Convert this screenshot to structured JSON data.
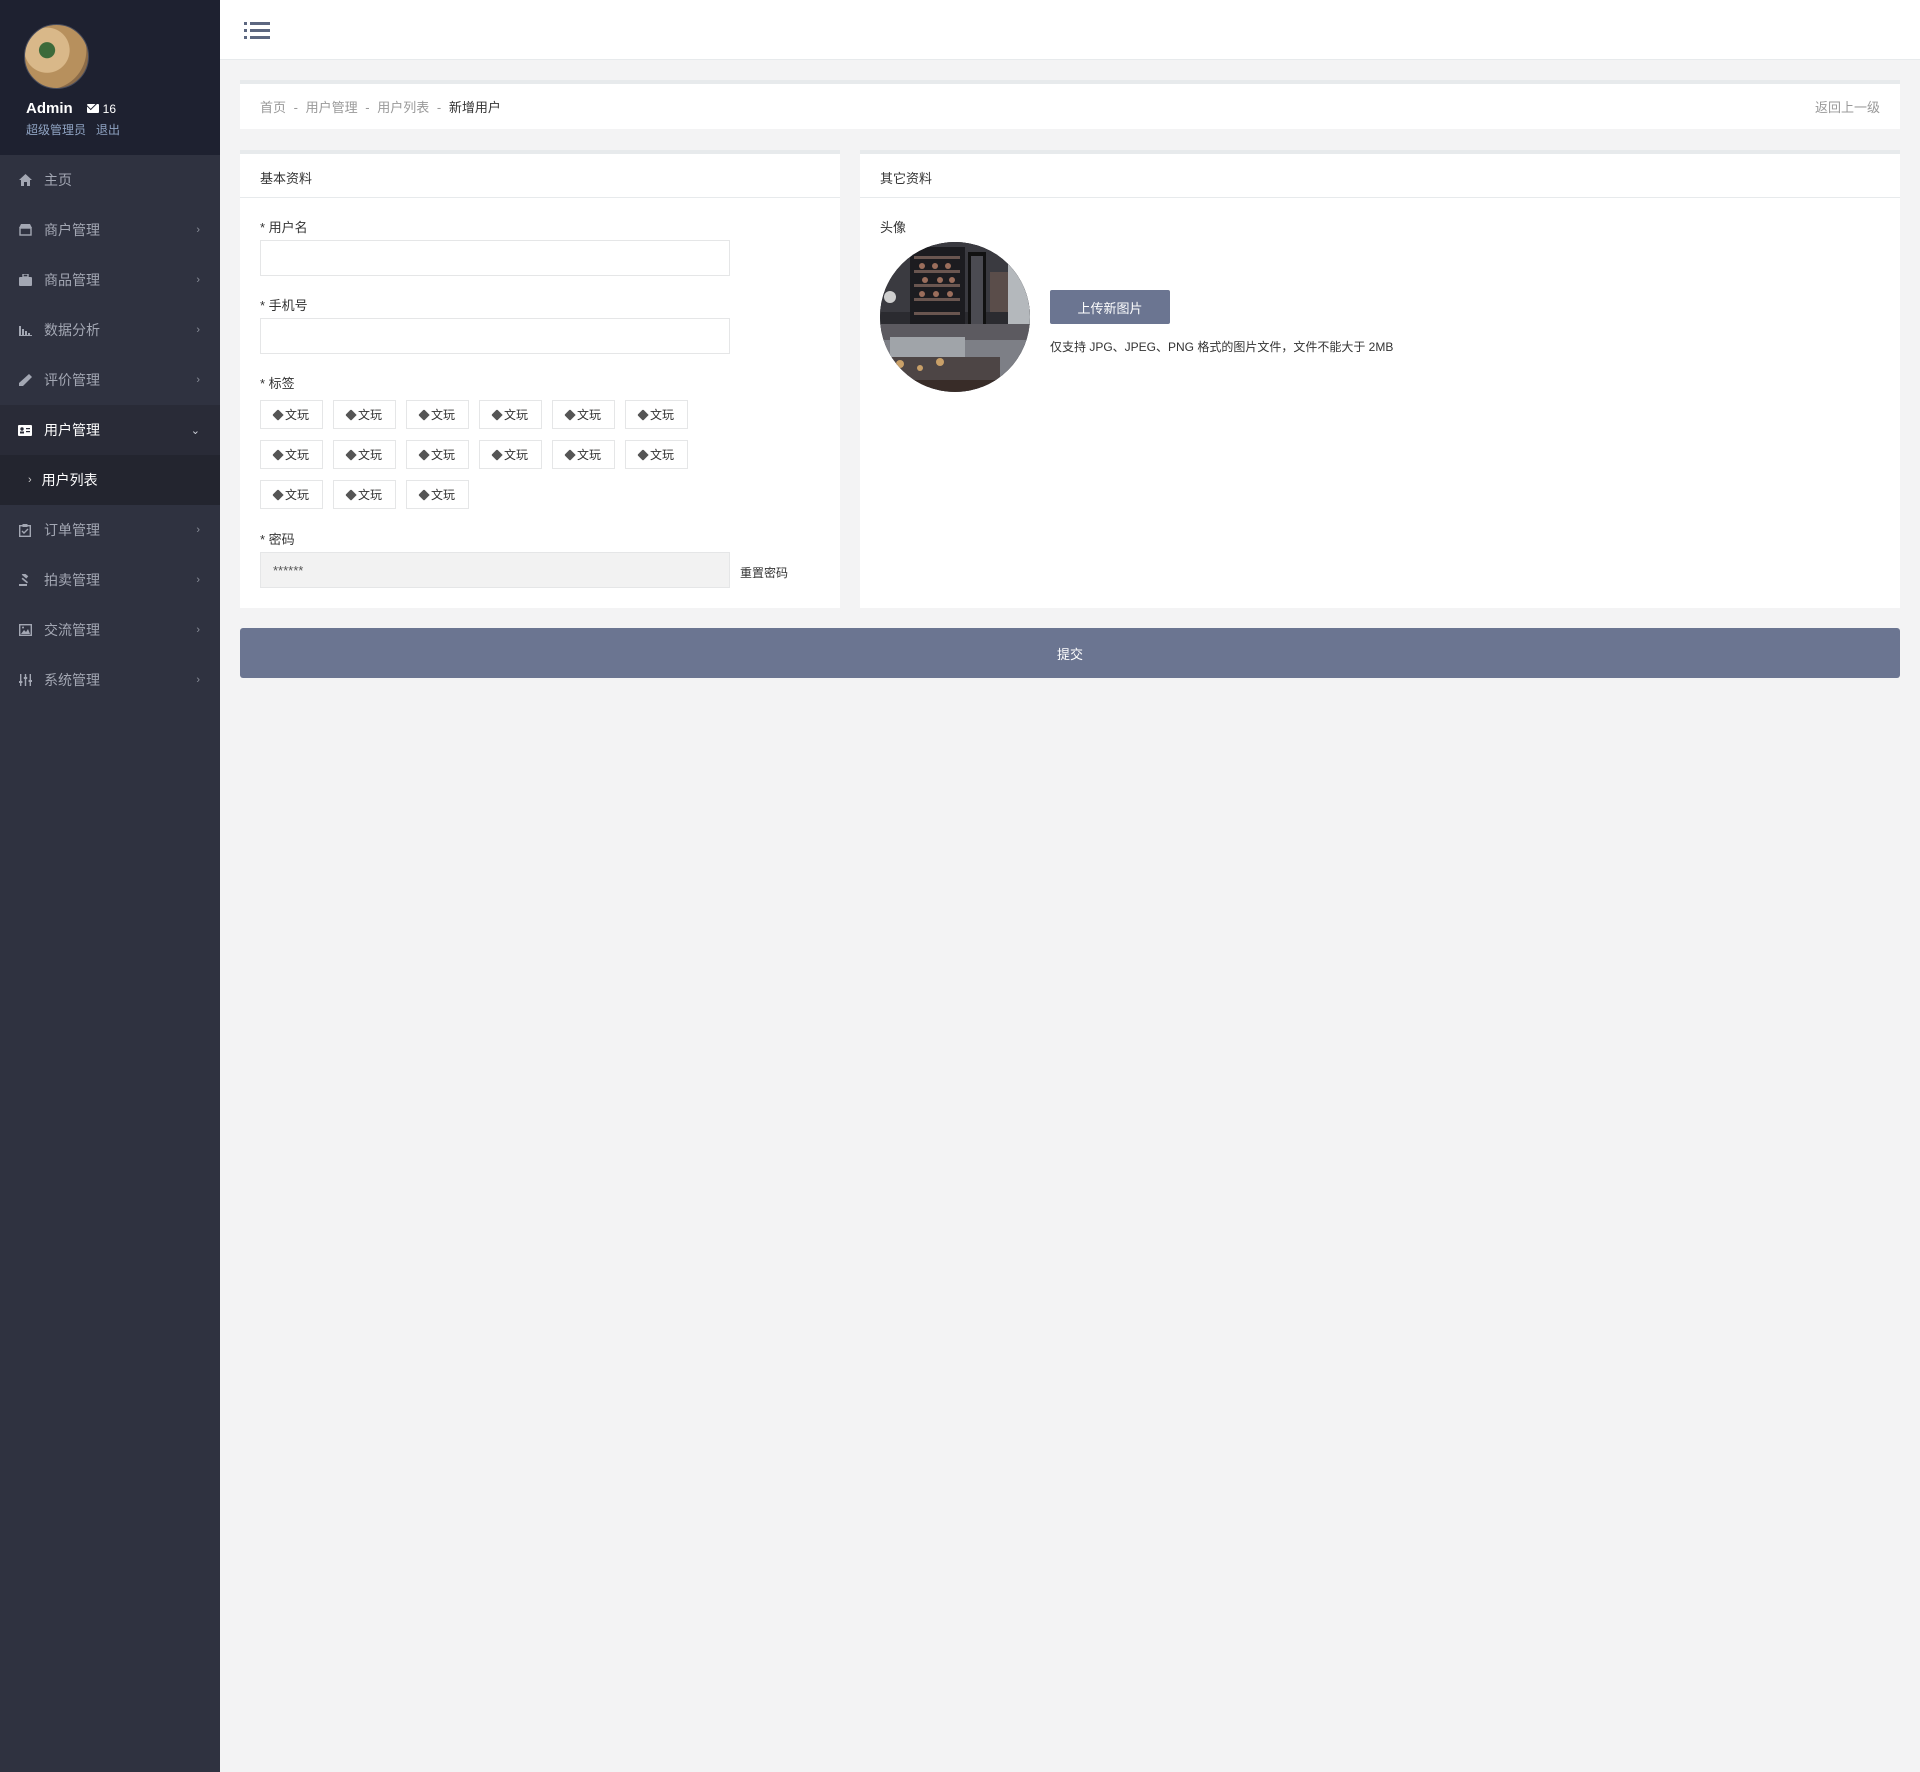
{
  "sidebar": {
    "profile": {
      "name": "Admin",
      "mail_count": "16",
      "role": "超级管理员",
      "logout": "退出"
    },
    "items": [
      {
        "label": "主页",
        "icon": "home-icon"
      },
      {
        "label": "商户管理",
        "icon": "store-icon"
      },
      {
        "label": "商品管理",
        "icon": "briefcase-icon"
      },
      {
        "label": "数据分析",
        "icon": "bar-chart-icon"
      },
      {
        "label": "评价管理",
        "icon": "pencil-icon"
      },
      {
        "label": "用户管理",
        "icon": "id-card-icon"
      },
      {
        "label": "订单管理",
        "icon": "clipboard-icon"
      },
      {
        "label": "拍卖管理",
        "icon": "gavel-icon"
      },
      {
        "label": "交流管理",
        "icon": "image-icon"
      },
      {
        "label": "系统管理",
        "icon": "sliders-icon"
      }
    ],
    "active_sub": "用户列表"
  },
  "breadcrumb": {
    "home": "首页",
    "level1": "用户管理",
    "level2": "用户列表",
    "current": "新增用户",
    "separator": "-",
    "back": "返回上一级"
  },
  "basic": {
    "title": "基本资料",
    "username_label": "* 用户名",
    "username_value": "",
    "phone_label": "* 手机号",
    "phone_value": "",
    "tags_label": "* 标签",
    "tags": [
      "文玩",
      "文玩",
      "文玩",
      "文玩",
      "文玩",
      "文玩",
      "文玩",
      "文玩",
      "文玩",
      "文玩",
      "文玩",
      "文玩",
      "文玩",
      "文玩",
      "文玩"
    ],
    "password_label": "* 密码",
    "password_value": "******",
    "reset_password": "重置密码"
  },
  "other": {
    "title": "其它资料",
    "avatar_label": "头像",
    "upload_button": "上传新图片",
    "upload_hint": "仅支持 JPG、JPEG、PNG 格式的图片文件，文件不能大于 2MB"
  },
  "submit_label": "提交",
  "colors": {
    "sidebar_bg": "#2f3240",
    "profile_bg": "#1e2130",
    "accent": "#6b7591",
    "page_bg": "#f3f3f4"
  }
}
